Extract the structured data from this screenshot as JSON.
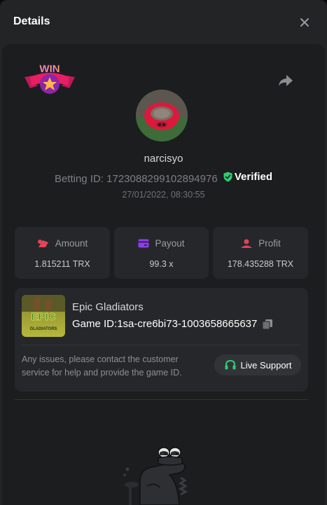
{
  "header": {
    "title": "Details",
    "close_icon": "close-icon"
  },
  "badge": {
    "text": "WIN",
    "icon": "win-star-badge"
  },
  "share_icon": "share-icon",
  "user": {
    "username": "narcisyo",
    "betting_label": "Betting ID:",
    "betting_id": "1723088299102894976",
    "verified_label": "Verified",
    "timestamp": "27/01/2022, 08:30:55"
  },
  "stats": [
    {
      "label": "Amount",
      "value": "1.815211 TRX",
      "icon": "amount-icon",
      "color": "#e0455a"
    },
    {
      "label": "Payout",
      "value": "99.3 x",
      "icon": "payout-icon",
      "color": "#8b3fe8"
    },
    {
      "label": "Profit",
      "value": "178.435288 TRX",
      "icon": "profit-icon",
      "color": "#e0455a"
    }
  ],
  "game": {
    "name": "Epic Gladiators",
    "id_label": "Game ID:",
    "id_value": "1sa-cre6bi73-1003658665637",
    "thumb_title": "EPIC",
    "thumb_sub": "GLADIATORS",
    "support_text": "Any issues, please contact the customer service for help and provide the game ID.",
    "support_button": "Live Support"
  },
  "colors": {
    "accent_green": "#2ecc71",
    "modal_bg": "#232426",
    "card_bg": "#1c1d1f",
    "box_bg": "#26272a"
  }
}
